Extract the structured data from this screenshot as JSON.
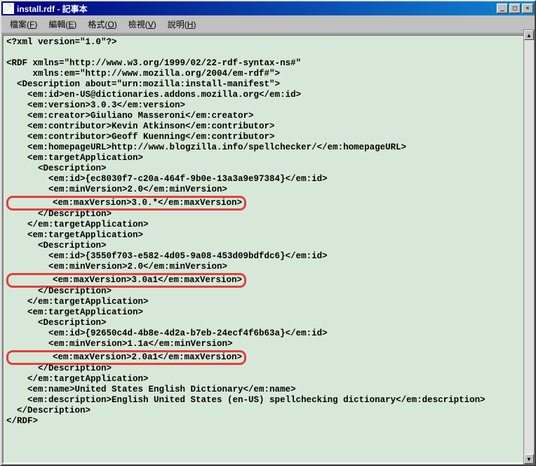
{
  "window": {
    "title": "install.rdf - 記事本"
  },
  "menubar": {
    "items": [
      {
        "label": "檔案",
        "accel": "F"
      },
      {
        "label": "編輯",
        "accel": "E"
      },
      {
        "label": "格式",
        "accel": "O"
      },
      {
        "label": "檢視",
        "accel": "V"
      },
      {
        "label": "說明",
        "accel": "H"
      }
    ]
  },
  "content": {
    "l01": "<?xml version=\"1.0\"?>",
    "l02": "",
    "l03": "<RDF xmlns=\"http://www.w3.org/1999/02/22-rdf-syntax-ns#\"",
    "l04": "     xmlns:em=\"http://www.mozilla.org/2004/em-rdf#\">",
    "l05": "  <Description about=\"urn:mozilla:install-manifest\">",
    "l06": "    <em:id>en-US@dictionaries.addons.mozilla.org</em:id>",
    "l07": "    <em:version>3.0.3</em:version>",
    "l08": "    <em:creator>Giuliano Masseroni</em:creator>",
    "l09": "    <em:contributor>Kevin Atkinson</em:contributor>",
    "l10": "    <em:contributor>Geoff Kuenning</em:contributor>",
    "l11": "    <em:homepageURL>http://www.blogzilla.info/spellchecker/</em:homepageURL>",
    "l12": "    <em:targetApplication>",
    "l13": "      <Description>",
    "l14": "        <em:id>{ec8030f7-c20a-464f-9b0e-13a3a9e97384}</em:id>",
    "l15": "        <em:minVersion>2.0</em:minVersion>",
    "l16_hl": "        <em:maxVersion>3.0.*</em:maxVersion>",
    "l17": "      </Description>",
    "l18": "    </em:targetApplication>",
    "l19": "    <em:targetApplication>",
    "l20": "      <Description>",
    "l21": "        <em:id>{3550f703-e582-4d05-9a08-453d09bdfdc6}</em:id>",
    "l22": "        <em:minVersion>2.0</em:minVersion>",
    "l23_hl": "        <em:maxVersion>3.0a1</em:maxVersion>",
    "l24": "      </Description>",
    "l25": "    </em:targetApplication>",
    "l26": "    <em:targetApplication>",
    "l27": "      <Description>",
    "l28": "        <em:id>{92650c4d-4b8e-4d2a-b7eb-24ecf4f6b63a}</em:id>",
    "l29": "        <em:minVersion>1.1a</em:minVersion>",
    "l30_hl": "        <em:maxVersion>2.0a1</em:maxVersion>",
    "l31": "      </Description>",
    "l32": "    </em:targetApplication>",
    "l33": "    <em:name>United States English Dictionary</em:name>",
    "l34": "    <em:description>English United States (en-US) spellchecking dictionary</em:description>",
    "l35": "  </Description>",
    "l36": "</RDF>"
  }
}
